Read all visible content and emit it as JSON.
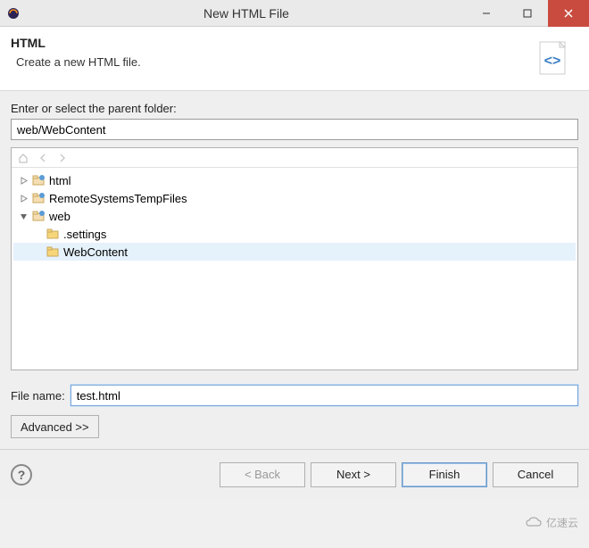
{
  "window": {
    "title": "New HTML File"
  },
  "banner": {
    "title": "HTML",
    "description": "Create a new HTML file."
  },
  "parent_folder": {
    "label": "Enter or select the parent folder:",
    "value": "web/WebContent"
  },
  "tree": {
    "items": [
      {
        "label": "html",
        "indent": 0,
        "expandable": true,
        "expanded": false,
        "icon": "project"
      },
      {
        "label": "RemoteSystemsTempFiles",
        "indent": 0,
        "expandable": true,
        "expanded": false,
        "icon": "project"
      },
      {
        "label": "web",
        "indent": 0,
        "expandable": true,
        "expanded": true,
        "icon": "project"
      },
      {
        "label": ".settings",
        "indent": 1,
        "expandable": false,
        "expanded": false,
        "icon": "folder"
      },
      {
        "label": "WebContent",
        "indent": 1,
        "expandable": false,
        "expanded": false,
        "icon": "folder",
        "selected": true
      }
    ]
  },
  "filename": {
    "label": "File name:",
    "value": "test.html"
  },
  "advanced": {
    "label": "Advanced >>"
  },
  "buttons": {
    "back": "< Back",
    "next": "Next >",
    "finish": "Finish",
    "cancel": "Cancel"
  },
  "watermark": "亿速云"
}
